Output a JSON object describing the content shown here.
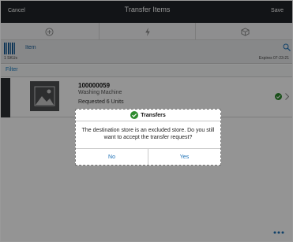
{
  "header": {
    "cancel_label": "Cancel",
    "title": "Transfer Items",
    "save_label": "Save",
    "background": "#1f2328"
  },
  "toolbar": {
    "icons": [
      "add-circle-icon",
      "lightning-icon",
      "package-icon"
    ]
  },
  "item_bar": {
    "label": "Item",
    "sku_count": "1 SKUs",
    "expires": "Expires 07-23-21"
  },
  "filter": {
    "label": "Filter"
  },
  "list": {
    "items": [
      {
        "number": "100000059",
        "description": "Washing Machine",
        "requested": "Requested 6 Units",
        "status_icon": "check-circle-icon",
        "status_color": "#2e8b2e"
      }
    ]
  },
  "dialog": {
    "title": "Transfers",
    "message": "The destination store is an excluded store. Do you still want to accept the transfer request?",
    "no_label": "No",
    "yes_label": "Yes",
    "accent": "#1b6fb5"
  },
  "footer": {
    "more_icon": "more-icon"
  }
}
